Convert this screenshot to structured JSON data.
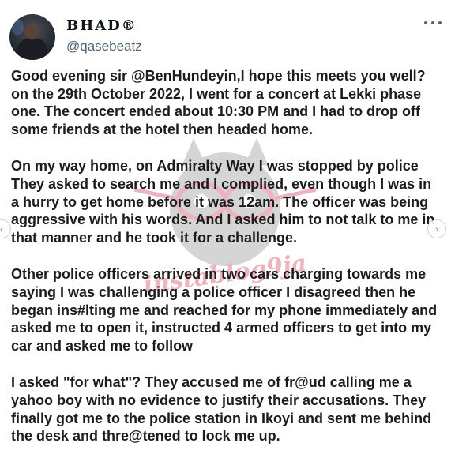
{
  "user": {
    "display_name": "BHAD®",
    "handle": "@qasebeatz"
  },
  "tweet": {
    "paragraphs": [
      "Good evening sir @BenHundeyin,I hope this meets you well? on the 29th October 2022, I went for a concert at Lekki phase one. The concert ended about 10:30 PM and I had to drop off some friends at the hotel then headed home.",
      "On my way home, on Admiralty Way I was stopped by police They asked to search me and I complied, even though I was in a hurry to get home before it was 12am. The officer was being aggressive with his words. And I asked him to not talk to me in that manner and he took it for a challenge.",
      "Other police officers arrived in two cars charging towards me saying I was challenging a police officer I disagreed then he began ins#lting me and reached for my phone immediately and asked me to open it, instructed 4 armed officers to get into my car and asked me to follow",
      "I asked \"for what\"? They accused me of fr@ud calling me a yahoo boy with no evidence to justify their accusations. They finally got me to the police station in Ikoyi and sent me behind the desk and thre@tened to lock me up."
    ]
  },
  "watermark": {
    "text": "instablog9ja",
    "color": "#cc2a4a"
  },
  "icons": {
    "more": "more-horizontal-icon",
    "prev": "chevron-left-icon",
    "next": "chevron-right-icon"
  },
  "nav": {
    "prev_glyph": "‹",
    "next_glyph": "›"
  }
}
